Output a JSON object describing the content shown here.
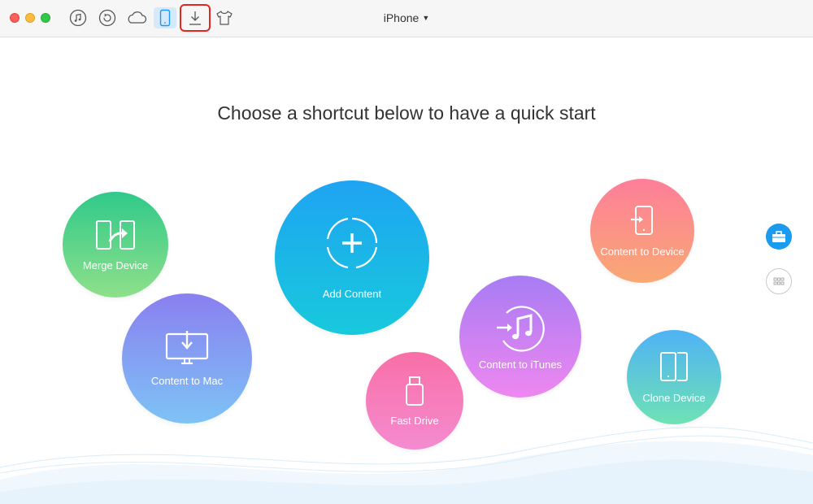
{
  "titlebar": {
    "device_name": "iPhone",
    "toolbar_icons": [
      "music-icon",
      "restore-icon",
      "cloud-icon",
      "phone-icon",
      "download-icon",
      "tshirt-icon"
    ],
    "active": "phone-icon",
    "highlighted": "download-icon"
  },
  "main": {
    "headline": "Choose a shortcut below to have a quick start"
  },
  "shortcuts": {
    "merge_device": "Merge Device",
    "content_to_mac": "Content to Mac",
    "add_content": "Add Content",
    "fast_drive": "Fast Drive",
    "content_to_itunes": "Content to iTunes",
    "content_to_device": "Content to Device",
    "clone_device": "Clone Device"
  },
  "colors": {
    "accent": "#1a9bf0",
    "highlight_border": "#e3261b"
  }
}
